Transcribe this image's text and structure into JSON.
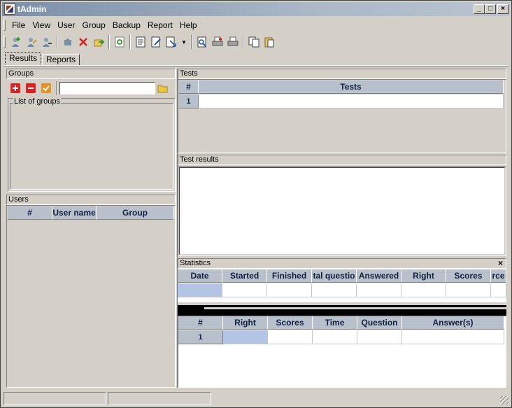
{
  "window": {
    "title": "tAdmin",
    "controls": {
      "minimize": "_",
      "maximize": "□",
      "close": "×"
    }
  },
  "menu": [
    "File",
    "View",
    "User",
    "Group",
    "Backup",
    "Report",
    "Help"
  ],
  "toolbar": {
    "groups": [
      [
        "add-user-icon",
        "edit-user-icon",
        "user-props-icon"
      ],
      [
        "puzzle-icon",
        "delete-icon",
        "import-icon"
      ],
      [
        "refresh-icon"
      ],
      [
        "report-icon",
        "edit-report-icon",
        "export-icon"
      ],
      [
        "preview-icon",
        "print-setup-icon",
        "print-icon"
      ],
      [
        "copy-icon",
        "paste-icon"
      ]
    ],
    "colors": {
      "accent_green": "#3a9a2a",
      "accent_red": "#d02020",
      "accent_blue": "#2a5aaa"
    }
  },
  "tabs": [
    {
      "label": "Results",
      "active": true
    },
    {
      "label": "Reports",
      "active": false
    }
  ],
  "groups_panel": {
    "title": "Groups",
    "list_label": "List of groups",
    "search_value": ""
  },
  "users_panel": {
    "title": "Users",
    "columns": [
      "#",
      "User name",
      "Group"
    ]
  },
  "tests_panel": {
    "title": "Tests",
    "columns": [
      "#",
      "Tests"
    ],
    "rows": [
      {
        "num": "1",
        "test": ""
      }
    ]
  },
  "test_results_panel": {
    "title": "Test results"
  },
  "statistics_panel": {
    "title": "Statistics",
    "close": "×",
    "columns": [
      "Date",
      "Started",
      "Finished",
      "tal questio",
      "Answered",
      "Right",
      "Scores",
      "rce"
    ]
  },
  "answers_panel": {
    "columns": [
      "#",
      "Right",
      "Scores",
      "Time",
      "Question",
      "Answer(s)"
    ],
    "rows": [
      {
        "num": "1"
      }
    ]
  }
}
